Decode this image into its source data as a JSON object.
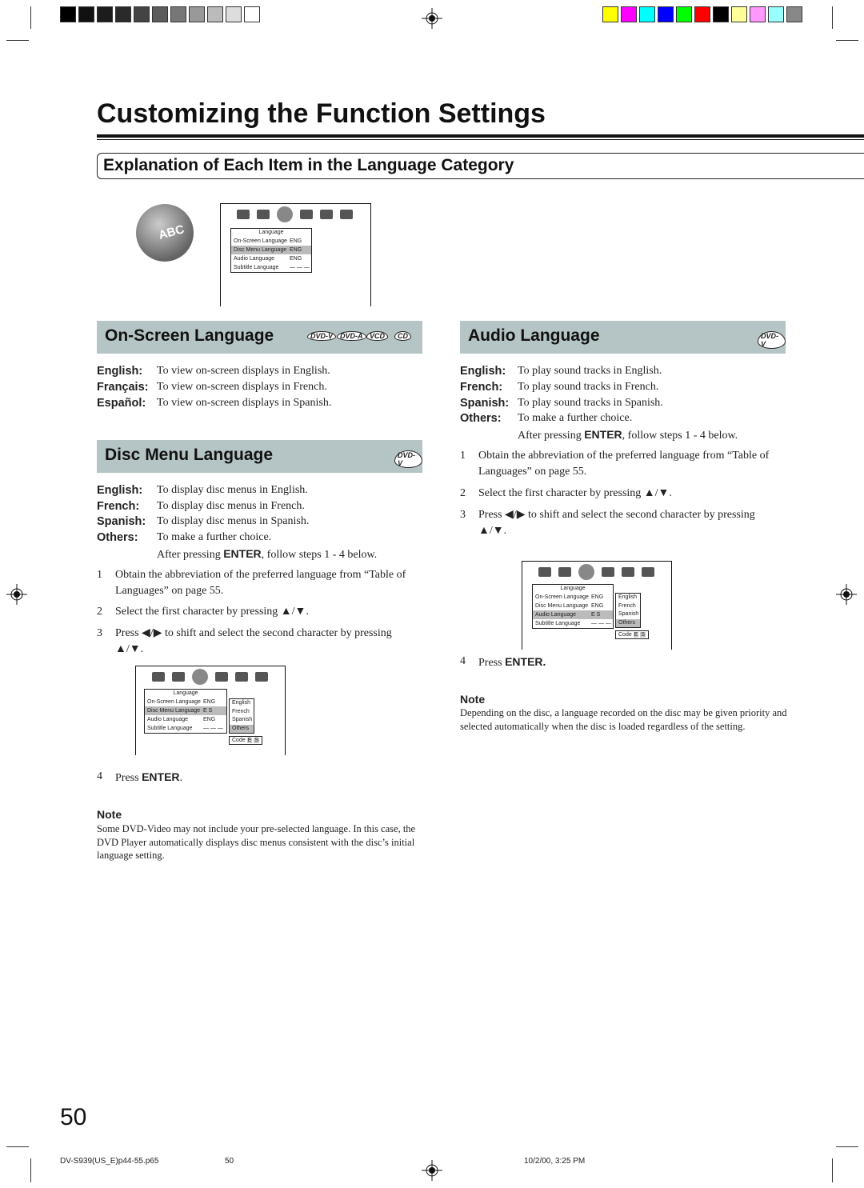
{
  "registration": {
    "gray_swatches": [
      "#000000",
      "#111111",
      "#1c1c1c",
      "#2a2a2a",
      "#444444",
      "#5c5c5c",
      "#777777",
      "#999999",
      "#bbbbbb",
      "#dddddd",
      "#ffffff"
    ],
    "color_swatches": [
      "#ffff00",
      "#ff00ff",
      "#00ffff",
      "#0000ff",
      "#00ff00",
      "#ff0000",
      "#000000",
      "#ffff99",
      "#ff99ff",
      "#99ffff",
      "#888888"
    ]
  },
  "title": "Customizing the Function Settings",
  "subtitle": "Explanation of Each Item in the Language Category",
  "abc_icon": "ABC",
  "menu": {
    "header": "Language",
    "rows": [
      {
        "label": "On-Screen Language",
        "value": "ENG"
      },
      {
        "label": "Disc Menu Language",
        "value": "ENG"
      },
      {
        "label": "Audio Language",
        "value": "ENG"
      },
      {
        "label": "Subtitle Language",
        "value": "— — —"
      }
    ]
  },
  "onscreen": {
    "title": "On-Screen Language",
    "logos": [
      "DVD-V",
      "DVD-A",
      "VCD",
      "CD"
    ],
    "items": [
      {
        "k": "English:",
        "v": "To view on-screen displays in English."
      },
      {
        "k": "Français:",
        "v": "To view on-screen displays in French."
      },
      {
        "k": "Español:",
        "v": "To view on-screen displays in Spanish."
      }
    ]
  },
  "discmenu": {
    "title": "Disc Menu Language",
    "logos": [
      "DVD-V"
    ],
    "items": [
      {
        "k": "English:",
        "v": "To display disc menus in English."
      },
      {
        "k": "French:",
        "v": "To display disc menus in French."
      },
      {
        "k": "Spanish:",
        "v": "To display disc menus in Spanish."
      },
      {
        "k": "Others:",
        "v": "To make a further choice."
      }
    ],
    "after_pre": "After pressing ",
    "after_bold": "ENTER",
    "after_post": ", follow steps 1 - 4 below.",
    "steps": [
      {
        "n": "1",
        "l1": "Obtain the abbreviation of the preferred language from “Table of",
        "l2": "Languages” on page 55."
      },
      {
        "n": "2",
        "l1": "Select the first character by pressing ▲/▼."
      },
      {
        "n": "3",
        "l1": "Press ◀/▶ to shift and select the second character by pressing",
        "l2": "▲/▼."
      }
    ],
    "screen": {
      "rows": [
        {
          "label": "On-Screen Language",
          "value": "ENG"
        },
        {
          "label": "Disc Menu Language",
          "value": "E  S"
        },
        {
          "label": "Audio Language",
          "value": "ENG"
        },
        {
          "label": "Subtitle Language",
          "value": "— — —"
        }
      ],
      "options": [
        "English",
        "French",
        "Spanish",
        "Others"
      ],
      "code_label": "Code",
      "code_chars": [
        "E",
        "S"
      ]
    },
    "step4_pre": "Press ",
    "step4_bold": "ENTER",
    "step4_post": ".",
    "note_title": "Note",
    "note": "Some DVD-Video may not include your pre-selected language. In this case, the DVD Player automatically displays disc menus consistent with the disc’s initial language setting."
  },
  "audio": {
    "title": "Audio Language",
    "logos": [
      "DVD-V"
    ],
    "items": [
      {
        "k": "English:",
        "v": "To play sound tracks in English."
      },
      {
        "k": "French:",
        "v": "To play sound tracks in French."
      },
      {
        "k": "Spanish:",
        "v": "To play sound tracks in Spanish."
      },
      {
        "k": "Others:",
        "v": "To make a further choice."
      }
    ],
    "after_pre": "After pressing ",
    "after_bold": "ENTER",
    "after_post": ", follow steps 1 - 4 below.",
    "steps": [
      {
        "n": "1",
        "l1": "Obtain the abbreviation of the preferred language from “Table of",
        "l2": "Languages” on page 55."
      },
      {
        "n": "2",
        "l1": "Select the first character by pressing ▲/▼."
      },
      {
        "n": "3",
        "l1": "Press ◀/▶ to shift and select the second character by pressing",
        "l2": "▲/▼."
      }
    ],
    "screen": {
      "rows": [
        {
          "label": "On-Screen Language",
          "value": "ENG"
        },
        {
          "label": "Disc Menu Language",
          "value": "ENG"
        },
        {
          "label": "Audio Language",
          "value": "E  S"
        },
        {
          "label": "Subtitle Language",
          "value": "— — —"
        }
      ],
      "options": [
        "English",
        "French",
        "Spanish",
        "Others"
      ],
      "code_label": "Code",
      "code_chars": [
        "E",
        "S"
      ]
    },
    "step4_pre": "Press ",
    "step4_bold": "ENTER.",
    "note_title": "Note",
    "note": "Depending on the disc, a language recorded on the disc may be given priority and selected automatically when the disc is loaded regardless of the setting."
  },
  "page_number": "50",
  "footer": {
    "file": "DV-S939(US_E)p44-55.p65",
    "page": "50",
    "date": "10/2/00, 3:25 PM"
  }
}
